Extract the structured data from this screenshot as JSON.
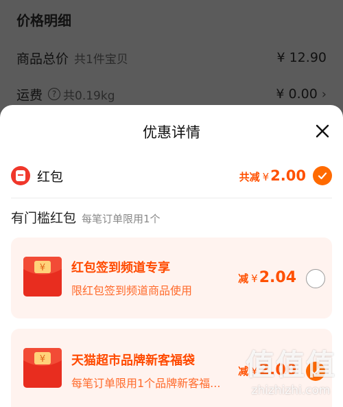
{
  "background": {
    "title": "价格明细",
    "rows": [
      {
        "label": "商品总价",
        "detail": "共1件宝贝",
        "amount": "¥ 12.90"
      },
      {
        "label": "运费",
        "detail": "共0.19kg",
        "amount": "¥ 0.00"
      }
    ]
  },
  "sheet": {
    "title": "优惠详情",
    "red_packet": {
      "label": "红包",
      "total_prefix": "共减",
      "currency": "¥",
      "total_value": "2.00"
    },
    "section": {
      "title": "有门槛红包",
      "subtitle": "每笔订单限用1个"
    },
    "coupons": [
      {
        "name": "红包签到频道专享",
        "desc": "限红包签到频道商品使用",
        "prefix": "减",
        "currency": "¥",
        "value": "2.04"
      },
      {
        "name": "天猫超市品牌新客福袋",
        "desc": "每笔订单限用1个品牌新客福...",
        "prefix": "减",
        "currency": "¥",
        "value": "2.00"
      }
    ]
  },
  "watermark": {
    "big": "值值值",
    "small": "zhizhizhi.com"
  },
  "colors": {
    "accent": "#ff5000",
    "check": "#ff6a00",
    "coupon_bg": "#fff3ef"
  }
}
